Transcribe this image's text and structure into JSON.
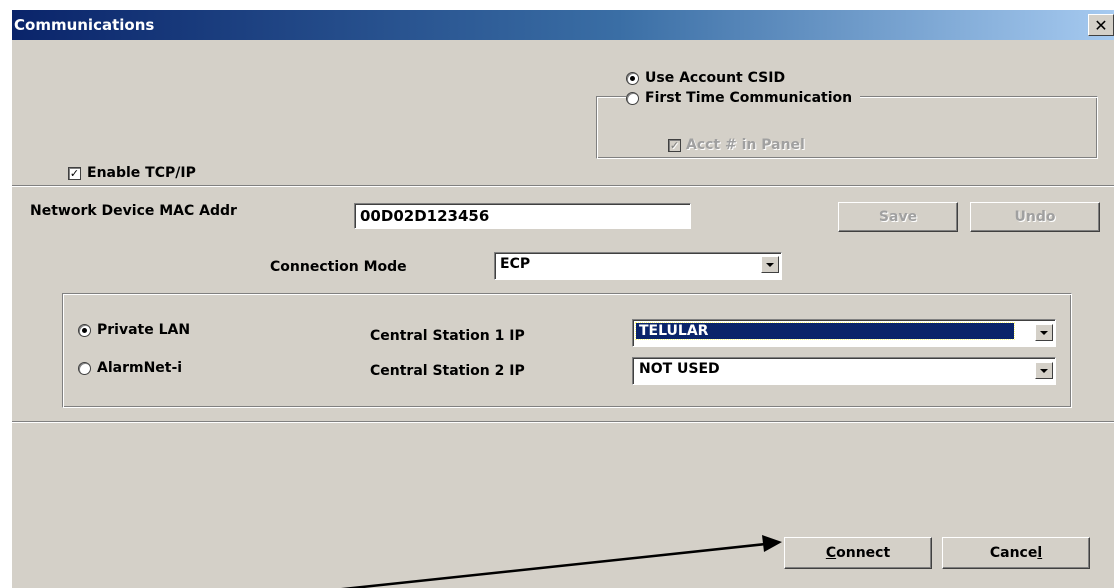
{
  "window": {
    "title": "Communications",
    "close_glyph": "✕"
  },
  "csid_group": {
    "use_account_csid": "Use Account CSID",
    "first_time_communication": "First Time Communication",
    "acct_in_panel": "Acct # in Panel",
    "selected": "use_account_csid"
  },
  "enable_tcpip": {
    "label": "Enable TCP/IP",
    "checked": true
  },
  "mac": {
    "label": "Network Device MAC Addr",
    "value": "00D02D123456"
  },
  "buttons": {
    "save": "Save",
    "undo": "Undo",
    "connect_prefix": "",
    "connect_underline": "C",
    "connect_rest": "onnect",
    "cancel_prefix": "Cance",
    "cancel_underline": "l",
    "cancel_rest": ""
  },
  "connection_mode": {
    "label": "Connection Mode",
    "value": "ECP"
  },
  "network": {
    "private_lan": "Private LAN",
    "alarmnet_i": "AlarmNet-i",
    "selected": "private_lan",
    "cs1_label": "Central Station 1 IP",
    "cs1_value": "TELULAR",
    "cs2_label": "Central Station 2 IP",
    "cs2_value": "NOT USED"
  },
  "icons": {
    "dropdown": "dropdown-arrow-icon",
    "close": "close-icon",
    "pointer": "arrow-annotation-icon"
  },
  "colors": {
    "title_gradient_start": "#0a246a",
    "title_gradient_end": "#a6caf0",
    "selection": "#0a246a",
    "dialog_face": "#d4d0c8"
  }
}
